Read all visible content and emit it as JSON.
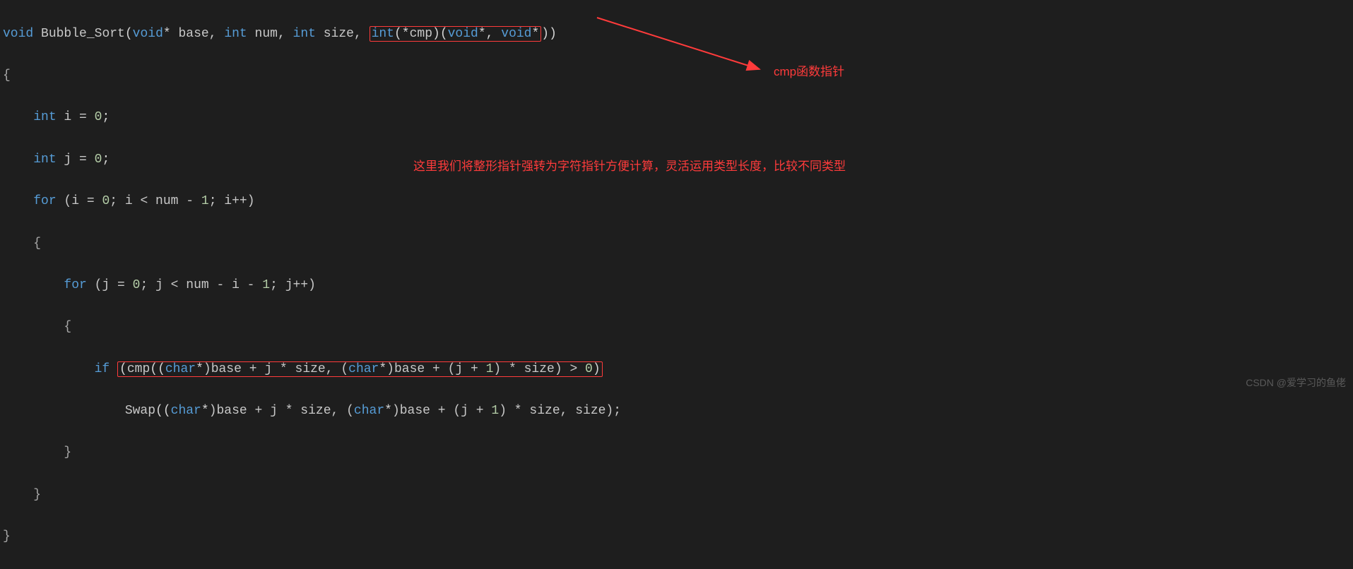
{
  "code": {
    "l1": {
      "void": "void",
      "fn": "Bubble_Sort",
      "p1_void": "void",
      "p1_star": "*",
      "p1_name": " base, ",
      "p2_int": "int",
      "p2_name": " num, ",
      "p3_int": "int",
      "p3_name": " size, ",
      "p4_box_int": "int",
      "p4_box_mid1": "(",
      "p4_box_star": "*",
      "p4_box_cmp": "cmp",
      "p4_box_mid2": ")(",
      "p4_box_void1": "void",
      "p4_box_star1": "*",
      "p4_box_comma": ", ",
      "p4_box_void2": "void",
      "p4_box_star2": "*",
      "p4_close": "))"
    },
    "l2": "{",
    "l3": {
      "int": "int",
      "rest": " i = ",
      "zero": "0",
      "semi": ";"
    },
    "l4": {
      "int": "int",
      "rest": " j = ",
      "zero": "0",
      "semi": ";"
    },
    "l5": {
      "for": "for",
      "open": " (i = ",
      "z": "0",
      "mid": "; i < num - ",
      "one": "1",
      "end": "; i++)"
    },
    "l6": "{",
    "l7": {
      "for": "for",
      "open": " (j = ",
      "z": "0",
      "mid": "; j < num - i - ",
      "one": "1",
      "end": "; j++)"
    },
    "l8": "{",
    "l9": {
      "if": "if",
      "sp": " ",
      "open": "(",
      "cmp": "cmp",
      "a1": "((",
      "char1": "char",
      "star1": "*",
      "b1": ")base + j * size, (",
      "char2": "char",
      "star2": "*",
      "b2": ")base + (j + ",
      "one": "1",
      "b3": ") * size) > ",
      "zero": "0",
      "close": ")"
    },
    "l10": {
      "swap": "Swap",
      "a1": "((",
      "char1": "char",
      "star1": "*",
      "b1": ")base + j * size, (",
      "char2": "char",
      "star2": "*",
      "b2": ")base + (j + ",
      "one": "1",
      "b3": ") * size, size);"
    },
    "l11": "}",
    "l12": "}",
    "l13": "}"
  },
  "annotations": {
    "cmp_pointer": "cmp函数指针",
    "cast_note": "这里我们将整形指针强转为字符指针方便计算，灵活运用类型长度，比较不同类型"
  },
  "watermark": "CSDN @爱学习的鱼佬"
}
